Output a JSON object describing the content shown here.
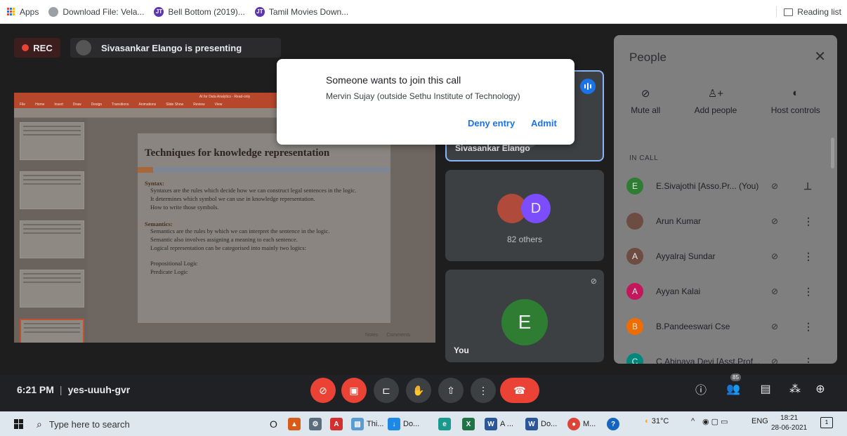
{
  "bookmarks": {
    "items": [
      {
        "label": "Apps"
      },
      {
        "label": "Download File: Vela..."
      },
      {
        "label": "Bell Bottom (2019)..."
      },
      {
        "label": "Tamil Movies Down..."
      }
    ],
    "reading_list": "Reading list"
  },
  "meet": {
    "rec_label": "REC",
    "presenting_label": "Sivasankar Elango is presenting",
    "time": "6:21 PM",
    "meeting_code": "yes-uuuh-gvr",
    "participant_count": "85"
  },
  "slide": {
    "window_title": "AI for Data Analytics - Read-only",
    "tabs": [
      "File",
      "Home",
      "Insert",
      "Draw",
      "Design",
      "Transitions",
      "Animations",
      "Slide Show",
      "Review",
      "View"
    ],
    "title": "Techniques for knowledge representation",
    "syntax_heading": "Syntax:",
    "syntax_lines": [
      "Syntaxes are the rules which decide how we can construct legal sentences in the logic.",
      "It determines which symbol we can use in knowledge representation.",
      "How to write those symbols."
    ],
    "semantics_heading": "Semantics:",
    "semantics_lines": [
      "Semantics are the rules by which we can interpret the sentence in the logic.",
      "Semantic also involves assigning a meaning to each sentence."
    ],
    "logical_line": "Logical representation can be categorised into mainly two logics:",
    "logic_types": [
      "Propositional Logic",
      "Predicate Logic"
    ],
    "footer_notes": "Notes",
    "footer_comments": "Comments"
  },
  "tiles": {
    "speaker_name": "Sivasankar Elango",
    "others_initial": "D",
    "others_label": "82 others",
    "you_initial": "E",
    "you_label": "You"
  },
  "dialog": {
    "title": "Someone wants to join this call",
    "subtitle": "Mervin Sujay (outside Sethu Institute of Technology)",
    "deny_label": "Deny entry",
    "admit_label": "Admit"
  },
  "people_panel": {
    "title": "People",
    "actions": [
      {
        "label": "Mute all",
        "icon": "mic-off-icon"
      },
      {
        "label": "Add people",
        "icon": "add-person-icon"
      },
      {
        "label": "Host controls",
        "icon": "toggle-icon"
      }
    ],
    "section_label": "IN CALL",
    "participants": [
      {
        "initial": "E",
        "name": "E.Sivajothi [Asso.Pr...  (You)",
        "color": "#2e7d32"
      },
      {
        "initial": "",
        "name": "Arun Kumar",
        "color": "#6d4c41"
      },
      {
        "initial": "A",
        "name": "Ayyalraj Sundar",
        "color": "#6d4c41"
      },
      {
        "initial": "A",
        "name": "Ayyan Kalai",
        "color": "#c2185b"
      },
      {
        "initial": "B",
        "name": "B.Pandeeswari Cse",
        "color": "#ef6c00"
      },
      {
        "initial": "C",
        "name": "C.Abinaya Devi [Asst.Prof...",
        "color": "#00897b"
      }
    ]
  },
  "taskbar": {
    "search_placeholder": "Type here to search",
    "apps": [
      {
        "label": "Thi..."
      },
      {
        "label": "Do..."
      },
      {
        "label": "A ..."
      },
      {
        "label": "Do..."
      },
      {
        "label": "M..."
      }
    ],
    "weather": "31°C",
    "language": "ENG",
    "time": "18:21",
    "date": "28-06-2021",
    "notification_count": "1"
  }
}
